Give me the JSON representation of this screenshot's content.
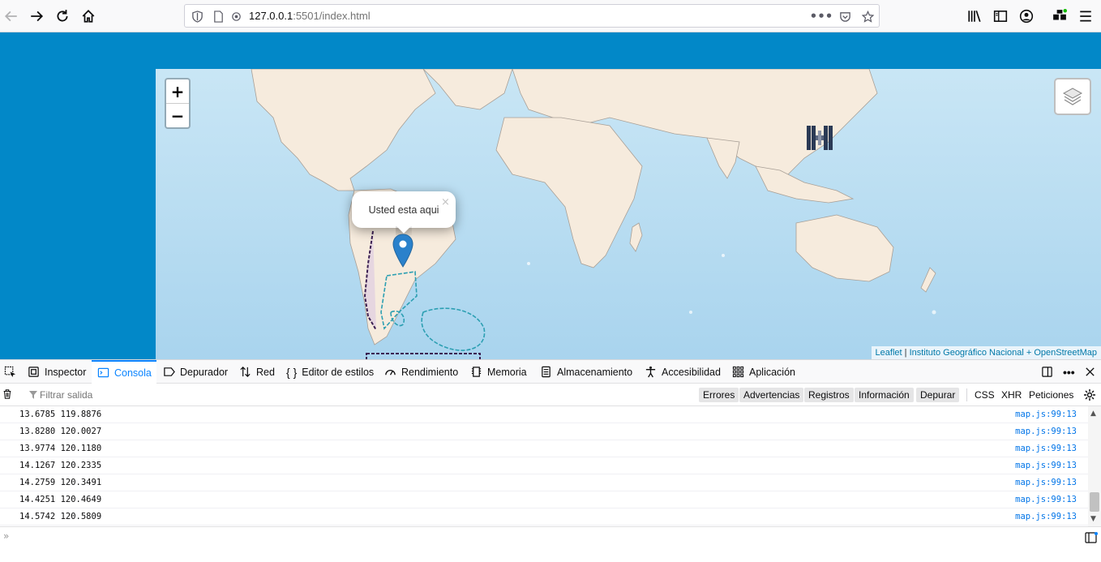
{
  "browser": {
    "url_host": "127.0.0.1",
    "url_rest": ":5501/index.html",
    "accent_color": "#0a84ff"
  },
  "map": {
    "zoom_in_label": "+",
    "zoom_out_label": "−",
    "popup_text": "Usted esta aqui",
    "popup_close": "×",
    "attribution_leaflet": "Leaflet",
    "attribution_separator": " | ",
    "attribution_source": "Instituto Geográfico Nacional + OpenStreetMap",
    "header_color": "#0288c8",
    "water_color": "#b5dbf0",
    "land_color": "#f6ebdd",
    "marker_color": "#2a81cb"
  },
  "devtools": {
    "tabs": [
      {
        "label": "Inspector",
        "icon": "inspector-icon"
      },
      {
        "label": "Consola",
        "icon": "console-icon"
      },
      {
        "label": "Depurador",
        "icon": "debugger-icon"
      },
      {
        "label": "Red",
        "icon": "network-icon"
      },
      {
        "label": "Editor de estilos",
        "icon": "style-editor-icon"
      },
      {
        "label": "Rendimiento",
        "icon": "performance-icon"
      },
      {
        "label": "Memoria",
        "icon": "memory-icon"
      },
      {
        "label": "Almacenamiento",
        "icon": "storage-icon"
      },
      {
        "label": "Accesibilidad",
        "icon": "accessibility-icon"
      },
      {
        "label": "Aplicación",
        "icon": "application-icon"
      }
    ],
    "filter_placeholder": "Filtrar salida",
    "filters": [
      "Errores",
      "Advertencias",
      "Registros",
      "Información",
      "Depurar"
    ],
    "extra_filters": [
      "CSS",
      "XHR",
      "Peticiones"
    ],
    "log": [
      {
        "msg": "13.6785 119.8876",
        "src": "map.js:99:13"
      },
      {
        "msg": "13.8280 120.0027",
        "src": "map.js:99:13"
      },
      {
        "msg": "13.9774 120.1180",
        "src": "map.js:99:13"
      },
      {
        "msg": "14.1267 120.2335",
        "src": "map.js:99:13"
      },
      {
        "msg": "14.2759 120.3491",
        "src": "map.js:99:13"
      },
      {
        "msg": "14.4251 120.4649",
        "src": "map.js:99:13"
      },
      {
        "msg": "14.5742 120.5809",
        "src": "map.js:99:13"
      }
    ]
  }
}
